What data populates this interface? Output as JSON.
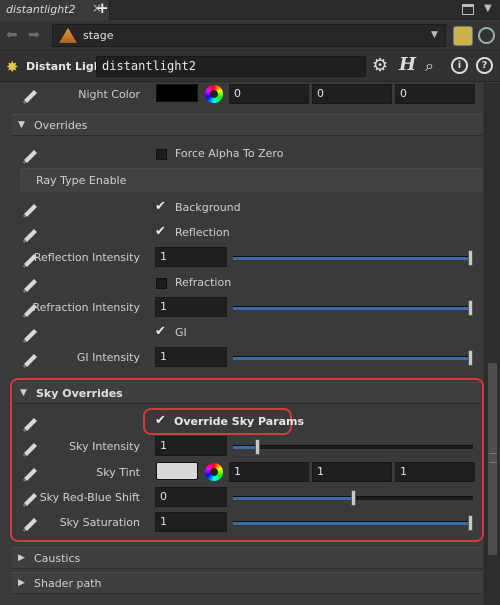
{
  "tab": {
    "label": "distantlight2"
  },
  "nav": {
    "path": "stage"
  },
  "header": {
    "node_type": "Distant Light",
    "node_name": "distantlight2"
  },
  "night_color": {
    "label": "Night Color",
    "swatch": "#000000",
    "values": [
      "0",
      "0",
      "0"
    ]
  },
  "overrides": {
    "title": "Overrides",
    "force_alpha": "Force Alpha To Zero",
    "ray_type_title": "Ray Type Enable",
    "background": "Background",
    "reflection": "Reflection",
    "reflection_intensity": {
      "label": "Reflection Intensity",
      "value": "1",
      "level": 1.0
    },
    "refraction": "Refraction",
    "refraction_intensity": {
      "label": "Refraction Intensity",
      "value": "1",
      "level": 1.0
    },
    "gi": "GI",
    "gi_intensity": {
      "label": "GI Intensity",
      "value": "1",
      "level": 1.0
    }
  },
  "sky": {
    "title": "Sky Overrides",
    "override_params": "Override Sky Params",
    "intensity": {
      "label": "Sky Intensity",
      "value": "1",
      "level": 0.1
    },
    "tint": {
      "label": "Sky Tint",
      "swatch": "#d9d9d9",
      "values": [
        "1",
        "1",
        "1"
      ]
    },
    "red_blue": {
      "label": "Sky Red-Blue Shift",
      "value": "0",
      "level": 0.5
    },
    "saturation": {
      "label": "Sky Saturation",
      "value": "1",
      "level": 1.0
    }
  },
  "folders": {
    "caustics": "Caustics",
    "shader_path": "Shader path"
  },
  "colors": {
    "accent": "#3d6aa8",
    "highlight": "#d23b3b"
  }
}
